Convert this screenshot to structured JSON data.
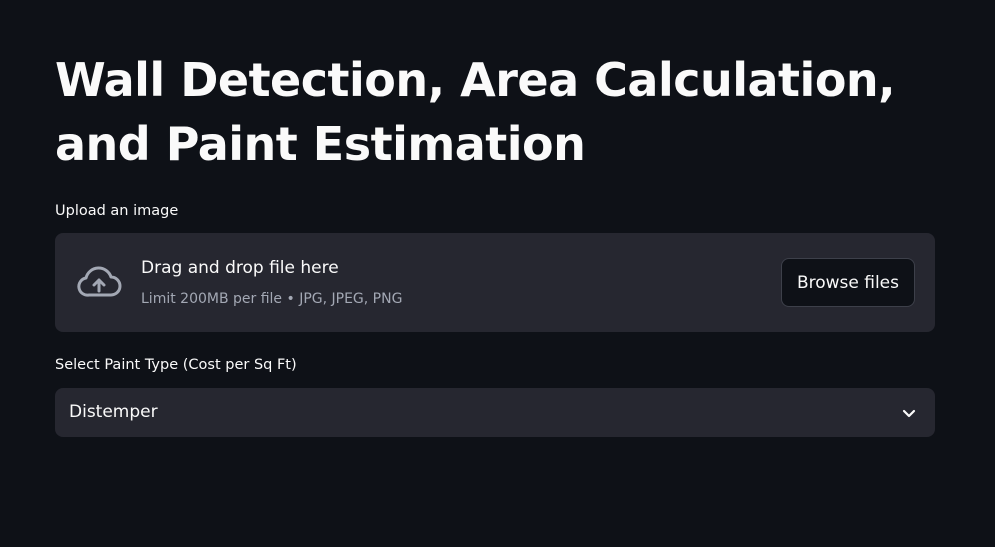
{
  "page": {
    "title": "Wall Detection, Area Calculation, and Paint Estimation"
  },
  "uploader": {
    "label": "Upload an image",
    "dropzone_text": "Drag and drop file here",
    "limit_text": "Limit 200MB per file • JPG, JPEG, PNG",
    "browse_label": "Browse files",
    "icon": "cloud-upload-icon"
  },
  "paint_select": {
    "label": "Select Paint Type (Cost per Sq Ft)",
    "selected": "Distemper",
    "icon": "chevron-down-icon"
  },
  "colors": {
    "background": "#0e1117",
    "surface": "#262730",
    "text": "#fafafa",
    "muted_text": "#a3a8b4"
  }
}
